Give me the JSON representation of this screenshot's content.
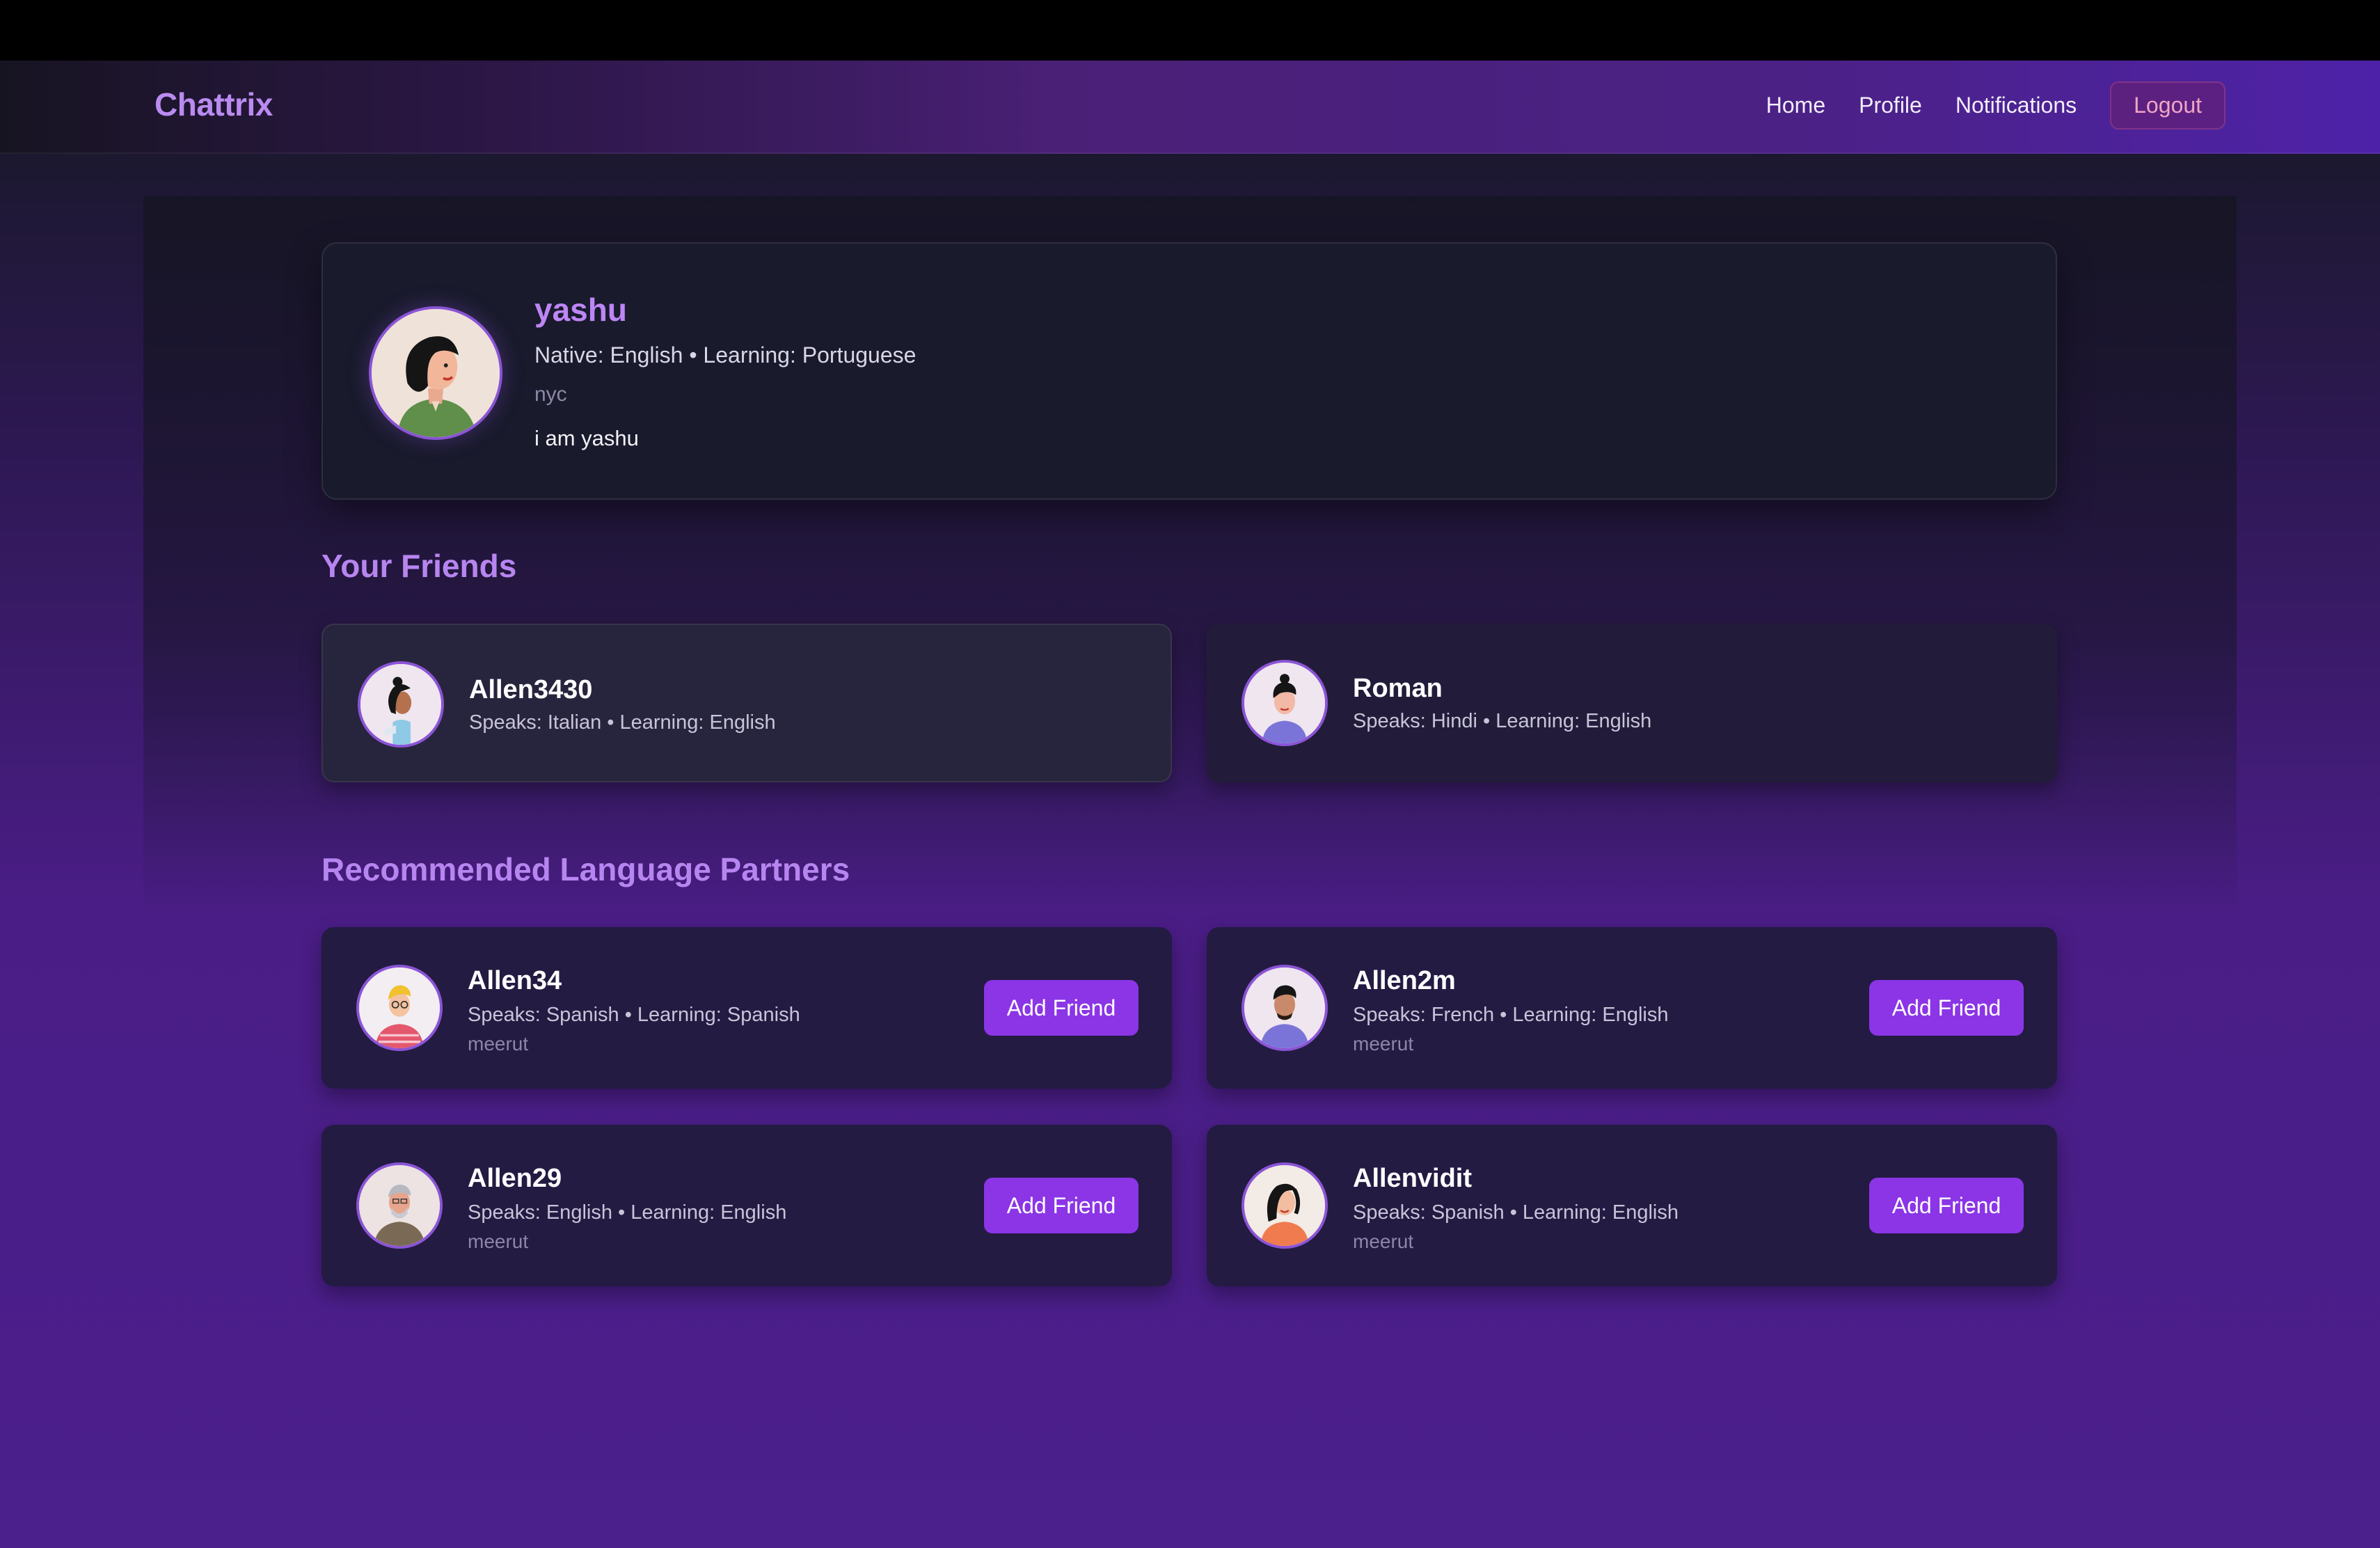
{
  "navbar": {
    "brand": "Chattrix",
    "links": [
      "Home",
      "Profile",
      "Notifications"
    ],
    "logout_label": "Logout"
  },
  "profile": {
    "name": "yashu",
    "languages": "Native: English • Learning: Portuguese",
    "location": "nyc",
    "bio": "i am yashu",
    "avatar": "woman-avatar-icon"
  },
  "friends": {
    "title": "Your Friends",
    "items": [
      {
        "name": "Allen3430",
        "languages": "Speaks: Italian • Learning: English",
        "avatar": "person-avatar-icon"
      },
      {
        "name": "Roman",
        "languages": "Speaks: Hindi • Learning: English",
        "avatar": "person-avatar-icon"
      }
    ]
  },
  "recommended": {
    "title": "Recommended Language Partners",
    "add_label": "Add Friend",
    "items": [
      {
        "name": "Allen34",
        "languages": "Speaks: Spanish • Learning: Spanish",
        "location": "meerut",
        "avatar": "person-avatar-icon"
      },
      {
        "name": "Allen2m",
        "languages": "Speaks: French • Learning: English",
        "location": "meerut",
        "avatar": "person-avatar-icon"
      },
      {
        "name": "Allen29",
        "languages": "Speaks: English • Learning: English",
        "location": "meerut",
        "avatar": "person-avatar-icon"
      },
      {
        "name": "Allenvidit",
        "languages": "Speaks: Spanish • Learning: English",
        "location": "meerut",
        "avatar": "person-avatar-icon"
      }
    ]
  },
  "colors": {
    "accent": "#8b35e6",
    "heading": "#b785f0",
    "logout": "#f0a6c4"
  }
}
